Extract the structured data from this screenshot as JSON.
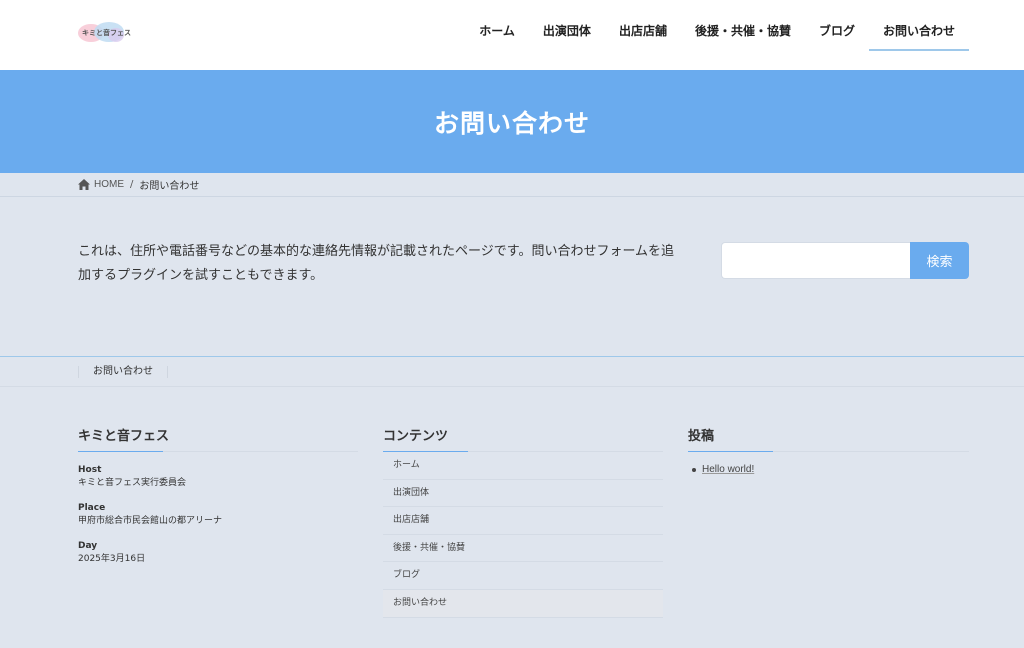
{
  "header": {
    "logo_text": "キミと音フェス",
    "nav": [
      {
        "label": "ホーム"
      },
      {
        "label": "出演団体"
      },
      {
        "label": "出店店舗"
      },
      {
        "label": "後援・共催・協賛"
      },
      {
        "label": "ブログ"
      },
      {
        "label": "お問い合わせ",
        "active": true
      }
    ]
  },
  "banner": {
    "title": "お問い合わせ"
  },
  "breadcrumb": {
    "home": "HOME",
    "separator": "/",
    "current": "お問い合わせ"
  },
  "main": {
    "text": "これは、住所や電話番号などの基本的な連絡先情報が記載されたページです。問い合わせフォームを追加するプラグインを試すこともできます。"
  },
  "search": {
    "placeholder": "",
    "button_label": "検索"
  },
  "footer_nav": {
    "items": [
      "お問い合わせ"
    ]
  },
  "widgets": {
    "about": {
      "title": "キミと音フェス",
      "blocks": [
        {
          "label": "Host",
          "value": "キミと音フェス実行委員会"
        },
        {
          "label": "Place",
          "value": "甲府市総合市民会館山の都アリーナ"
        },
        {
          "label": "Day",
          "value": "2025年3月16日"
        }
      ]
    },
    "contents": {
      "title": "コンテンツ",
      "items": [
        "ホーム",
        "出演団体",
        "出店店舗",
        "後援・共催・協賛",
        "ブログ",
        "お問い合わせ"
      ]
    },
    "posts": {
      "title": "投稿",
      "items": [
        "Hello world!"
      ]
    }
  },
  "colors": {
    "accent": "#6aabee",
    "background": "#dfe5ee",
    "header": "#ffffff"
  }
}
